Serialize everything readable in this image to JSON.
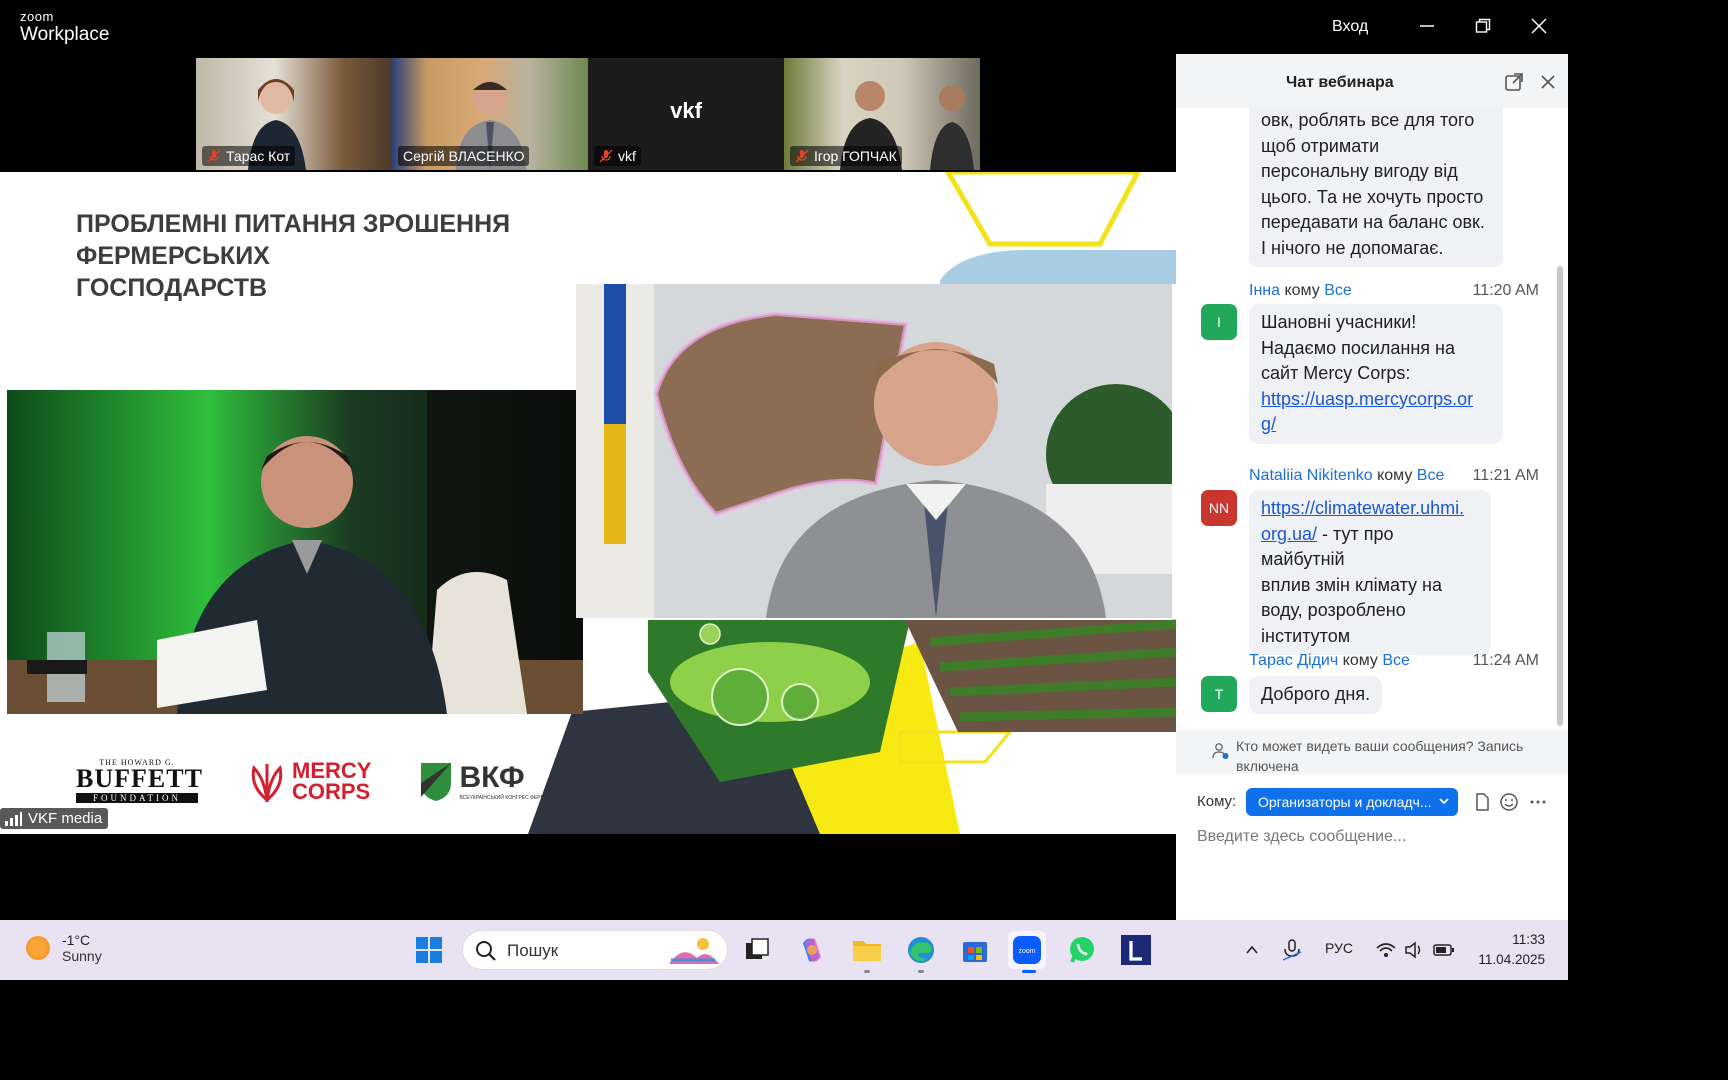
{
  "titlebar": {
    "brand_top": "zoom",
    "brand_bottom": "Workplace",
    "signin": "Вход"
  },
  "participants": [
    {
      "name": "Тарас Кот",
      "muted": true
    },
    {
      "name": "Сергій ВЛАСЕНКО",
      "muted": false
    },
    {
      "name": "vkf",
      "muted": true,
      "avatar_text": "vkf"
    },
    {
      "name": "Ігор ГОПЧАК",
      "muted": true
    }
  ],
  "slide": {
    "title_lines": [
      "ПРОБЛЕМНІ ПИТАННЯ ЗРОШЕННЯ",
      "ФЕРМЕРСЬКИХ",
      "ГОСПОДАРСТВ"
    ],
    "logos": {
      "buffett": [
        "THE HOWARD G.",
        "BUFFETT",
        "FOUNDATION"
      ],
      "mercy": [
        "MERCY",
        "CORPS"
      ],
      "vkf": "ВКФ",
      "vkf_sub": "ВСЕУКРАЇНСЬКИЙ КОНГРЕС ФЕРМЕРІВ"
    }
  },
  "active_speaker_label": "VKF media",
  "chat": {
    "title": "Чат вебинара",
    "to_word": "кому",
    "messages": [
      {
        "continued": true,
        "lines": [
          "овк, роблять все для того",
          "щоб отримати",
          "персональну вигоду від",
          "цього. Та не хочуть просто",
          "передавати на баланс овк.",
          "І нічого не допомагає."
        ]
      },
      {
        "from": "Інна",
        "to": "Все",
        "time": "11:20 AM",
        "avatar": "I",
        "avatar_color": "#22a85a",
        "lines": [
          "Шановні учасники!",
          "Надаємо посилання на",
          "сайт Mercy Corps:"
        ],
        "link_lines": [
          "https://uasp.mercycorps.or",
          "g/"
        ]
      },
      {
        "from": "Nataliia Nikitenko",
        "to": "Все",
        "time": "11:21 AM",
        "avatar": "NN",
        "avatar_color": "#c9362e",
        "link_lines": [
          "https://climatewater.uhmi.",
          "org.ua/"
        ],
        "after_link": " - тут про майбутній",
        "lines": [
          "вплив змін клімату на",
          "воду, розроблено",
          "інститутом"
        ]
      },
      {
        "from": "Тарас Дідич",
        "to": "Все",
        "time": "11:24 AM",
        "avatar": "T",
        "avatar_color": "#22a85a",
        "lines": [
          "Доброго дня."
        ]
      }
    ],
    "notice": "Кто может видеть ваши сообщения? Запись включена",
    "to_label": "Кому:",
    "to_value": "Организаторы и докладч...",
    "input_placeholder": "Введите здесь сообщение..."
  },
  "taskbar": {
    "weather_temp": "-1°C",
    "weather_text": "Sunny",
    "search_placeholder": "Пошук",
    "lang": "РУС",
    "time": "11:33",
    "date": "11.04.2025"
  }
}
